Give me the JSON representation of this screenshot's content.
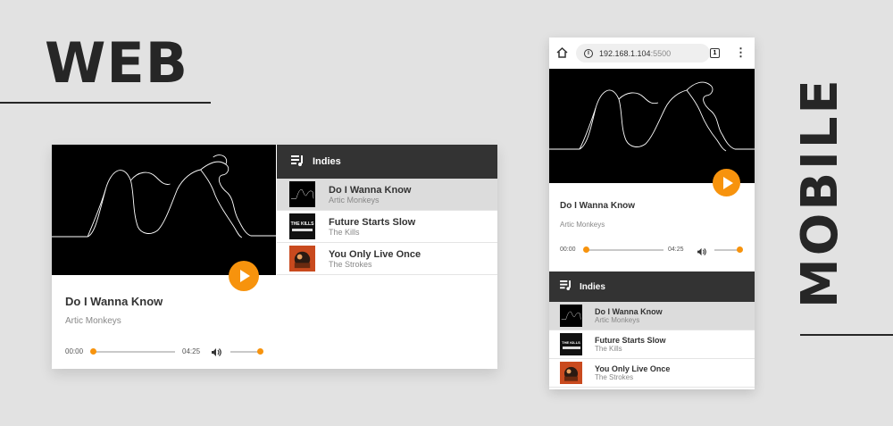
{
  "labels": {
    "web": "WEB",
    "mobile": "MOBILE"
  },
  "colors": {
    "accent": "#f7930d",
    "header": "#333333",
    "background": "#e2e2e2"
  },
  "player": {
    "now_playing": {
      "title": "Do I Wanna Know",
      "artist": "Artic Monkeys"
    },
    "current_time": "00:00",
    "duration": "04:25",
    "progress": 0,
    "volume": 1.0,
    "play_icon": "play-icon",
    "volume_icon": "volume-icon"
  },
  "playlist": {
    "name": "Indies",
    "icon": "playlist-icon",
    "tracks": [
      {
        "title": "Do I Wanna Know",
        "artist": "Artic Monkeys",
        "active": true
      },
      {
        "title": "Future Starts Slow",
        "artist": "The Kills",
        "active": false
      },
      {
        "title": "You Only Live Once",
        "artist": "The Strokes",
        "active": false
      }
    ]
  },
  "browser": {
    "url_host": "192.168.1.104",
    "url_port": ":5500",
    "tab_count": "1",
    "home_icon": "home-icon",
    "info_icon": "info-icon",
    "menu_icon": "more-vert-icon"
  },
  "album_text": {
    "kills_logo": "THE KILLS"
  }
}
